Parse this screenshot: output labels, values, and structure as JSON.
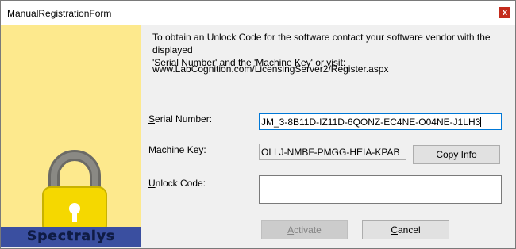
{
  "window": {
    "title": "ManualRegistrationForm",
    "close_glyph": "x"
  },
  "branding": {
    "logo_text": "Spectralys",
    "lock_icon": "padlock-icon",
    "panel_color": "#fde98d",
    "banner_color": "#3a4fa0"
  },
  "instructions": {
    "line1": "To obtain an Unlock Code for the software contact your software vendor with the displayed",
    "line2": "'Serial Number' and the 'Machine Key' or visit:",
    "url": "www.LabCognition.com/LicensingServer2/Register.aspx"
  },
  "form": {
    "serial": {
      "label_first": "S",
      "label_rest": "erial Number:",
      "value": "JM_3-8B11D-IZ11D-6QONZ-EC4NE-O04NE-J1LH3"
    },
    "machine": {
      "label": "Machine Key:",
      "value": "OLLJ-NMBF-PMGG-HEIA-KPAB"
    },
    "unlock": {
      "label_first": "U",
      "label_rest": "nlock Code:",
      "value": ""
    }
  },
  "buttons": {
    "copy_info": {
      "first": "C",
      "rest": "opy Info"
    },
    "activate": {
      "first": "A",
      "rest": "ctivate"
    },
    "cancel": {
      "first": "C",
      "rest": "ancel"
    }
  }
}
